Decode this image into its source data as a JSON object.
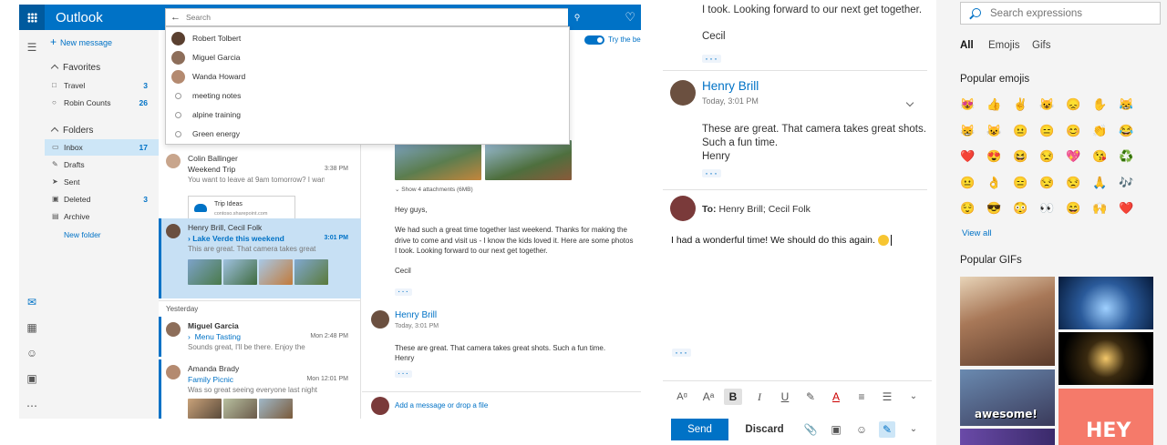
{
  "outlook": {
    "brand": "Outlook",
    "new_message": "New message",
    "favorites_header": "Favorites",
    "folders_header": "Folders",
    "favorites": [
      {
        "label": "Travel",
        "count": "3"
      },
      {
        "label": "Robin Counts",
        "count": "26"
      }
    ],
    "folders": [
      {
        "label": "Inbox",
        "count": "17"
      },
      {
        "label": "Drafts",
        "count": ""
      },
      {
        "label": "Sent",
        "count": ""
      },
      {
        "label": "Deleted",
        "count": "3"
      },
      {
        "label": "Archive",
        "count": ""
      }
    ],
    "new_folder": "New folder",
    "search": {
      "placeholder": "Search",
      "suggestions": [
        {
          "label": "Robert Tolbert",
          "kind": "person"
        },
        {
          "label": "Miguel Garcia",
          "kind": "person"
        },
        {
          "label": "Wanda Howard",
          "kind": "person"
        },
        {
          "label": "meeting notes",
          "kind": "history"
        },
        {
          "label": "alpine training",
          "kind": "history"
        },
        {
          "label": "Green energy",
          "kind": "history"
        }
      ]
    },
    "toggle_label": "Try the be",
    "messages": [
      {
        "from": "Colin Ballinger",
        "subject": "Weekend Trip",
        "preview": "You want to leave at 9am tomorrow? I want",
        "time": "3:38 PM",
        "attachment_name": "Trip Ideas",
        "attachment_url": "contoso.sharepoint.com"
      },
      {
        "from": "Henry Brill, Cecil Folk",
        "subject": "Lake Verde this weekend",
        "preview": "This are great. That camera takes great",
        "time": "3:01 PM"
      },
      {
        "from": "Miguel Garcia",
        "subject": "Menu Tasting",
        "preview": "Sounds great, I'll be there. Enjoy the",
        "time": "Mon 2:48 PM"
      },
      {
        "from": "Amanda Brady",
        "subject": "Family Picnic",
        "preview": "Was so great seeing everyone last night",
        "time": "Mon 12:01 PM"
      }
    ],
    "yesterday": "Yesterday",
    "reading": {
      "show_attachments": "Show 4 attachments (6MB)",
      "greeting": "Hey guys,",
      "body_lines": [
        "We had such a great time together last weekend. Thanks for making the",
        "drive to come and visit us - I know the kids loved it. Here are some photos",
        "I took. Looking forward to our next get together."
      ],
      "signoff": "Cecil",
      "dots": "···",
      "reply_from": "Henry Brill",
      "reply_time": "Today, 3:01 PM",
      "reply_body": "These are great. That camera takes great shots. Such a fun time.",
      "reply_sig": "Henry",
      "add_message": "Add a message or drop a file"
    }
  },
  "compose": {
    "quoted_tail": "I took. Looking forward to our next get together.",
    "quoted_sig": "Cecil",
    "dots": "···",
    "from_name": "Henry Brill",
    "from_time": "Today, 3:01 PM",
    "reply_lines": [
      "These are great. That camera takes great shots.",
      "Such a fun time.",
      "Henry"
    ],
    "to_label": "To:",
    "to_recipients": "Henry Brill; Cecil Folk",
    "draft": "I had a wonderful time!  We should do this again.",
    "send": "Send",
    "discard": "Discard"
  },
  "expressions": {
    "search_placeholder": "Search expressions",
    "tabs": [
      "All",
      "Emojis",
      "Gifs"
    ],
    "popular_emojis": "Popular emojis",
    "emoji_rows": [
      [
        "😻",
        "👍",
        "✌️",
        "😺",
        "😞",
        "✋",
        "😹"
      ],
      [
        "😸",
        "😺",
        "😐",
        "😑",
        "😊",
        "👏",
        "😂"
      ],
      [
        "❤️",
        "😍",
        "😆",
        "😒",
        "💖",
        "😘",
        "♻️"
      ],
      [
        "😐",
        "👌",
        "😑",
        "😒",
        "😒",
        "🙏",
        "🎶"
      ],
      [
        "😌",
        "😎",
        "😳",
        "👀",
        "😄",
        "🙌",
        "❤️"
      ]
    ],
    "view_all": "View all",
    "popular_gifs": "Popular GIFs",
    "gif_labels": [
      "awesome!",
      "HEY"
    ]
  }
}
